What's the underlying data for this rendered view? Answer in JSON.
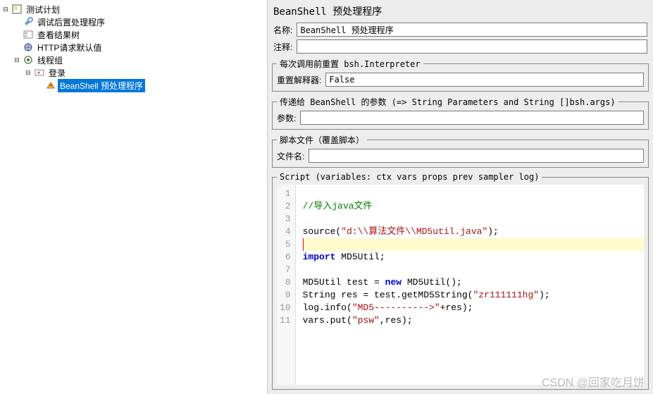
{
  "tree": {
    "testplan": "测试计划",
    "debug_post": "调试后置处理程序",
    "view_results": "查看结果树",
    "http_defaults": "HTTP请求默认值",
    "thread_group": "线程组",
    "login": "登录",
    "beanshell_pre": "BeanShell 预处理程序"
  },
  "panel": {
    "title": "BeanShell 预处理程序",
    "name_label": "名称:",
    "name_value": "BeanShell 预处理程序",
    "comment_label": "注释:",
    "comment_value": "",
    "reset_legend": "每次调用前重置 bsh.Interpreter",
    "reset_label": "重置解释器:",
    "reset_value": "False",
    "params_legend": "传递给 BeanShell 的参数 (=> String Parameters and String []bsh.args)",
    "params_label": "参数:",
    "params_value": "",
    "scriptfile_legend": "脚本文件（覆盖脚本）",
    "scriptfile_label": "文件名:",
    "scriptfile_value": "",
    "script_legend": "Script (variables: ctx vars props prev sampler log)"
  },
  "code": {
    "lines": [
      {
        "n": 1,
        "seg": []
      },
      {
        "n": 2,
        "seg": [
          {
            "t": "//导入java文件",
            "c": "c-comment"
          }
        ]
      },
      {
        "n": 3,
        "seg": []
      },
      {
        "n": 4,
        "seg": [
          {
            "t": "source(",
            "c": "c-ident"
          },
          {
            "t": "\"d:\\\\算法文件\\\\MD5util.java\"",
            "c": "c-string"
          },
          {
            "t": ");",
            "c": "c-ident"
          }
        ]
      },
      {
        "n": 5,
        "seg": [],
        "hl": true
      },
      {
        "n": 6,
        "seg": [
          {
            "t": "import",
            "c": "c-keyword"
          },
          {
            "t": " MD5Util;",
            "c": "c-ident"
          }
        ]
      },
      {
        "n": 7,
        "seg": []
      },
      {
        "n": 8,
        "seg": [
          {
            "t": "MD5Util test = ",
            "c": "c-type"
          },
          {
            "t": "new",
            "c": "c-keyword"
          },
          {
            "t": " MD5Util();",
            "c": "c-ident"
          }
        ]
      },
      {
        "n": 9,
        "seg": [
          {
            "t": "String res = test.getMD5String(",
            "c": "c-ident"
          },
          {
            "t": "\"zr111111hg\"",
            "c": "c-string"
          },
          {
            "t": ");",
            "c": "c-ident"
          }
        ]
      },
      {
        "n": 10,
        "seg": [
          {
            "t": "log.info(",
            "c": "c-ident"
          },
          {
            "t": "\"MD5---------->\"",
            "c": "c-string"
          },
          {
            "t": "+res);",
            "c": "c-ident"
          }
        ]
      },
      {
        "n": 11,
        "seg": [
          {
            "t": "vars.put(",
            "c": "c-ident"
          },
          {
            "t": "\"psw\"",
            "c": "c-string"
          },
          {
            "t": ",res);",
            "c": "c-ident"
          }
        ]
      }
    ]
  },
  "watermark": "CSDN @回家吃月饼"
}
